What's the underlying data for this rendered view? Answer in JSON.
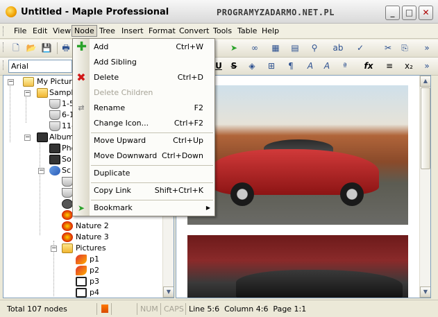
{
  "window": {
    "title": "Untitled - Maple Professional",
    "watermark": "PROGRAMYZADARMO.NET.PL",
    "min_glyph": "_",
    "max_glyph": "□",
    "close_glyph": "✕"
  },
  "menubar": {
    "items": [
      "File",
      "Edit",
      "View",
      "Node",
      "Tree",
      "Insert",
      "Format",
      "Convert",
      "Tools",
      "Table",
      "Help"
    ],
    "active_index": 3
  },
  "font_combo": {
    "value": "Arial"
  },
  "tree": {
    "nodes": [
      {
        "label": "My Picture",
        "icon": "book-icon"
      },
      {
        "label": "Sample",
        "icon": "folder-icon"
      },
      {
        "label": "1-5",
        "icon": "cup-icon"
      },
      {
        "label": "6-1",
        "icon": "cup-icon"
      },
      {
        "label": "11-",
        "icon": "cup-icon"
      },
      {
        "label": "Album",
        "icon": "camera-icon"
      },
      {
        "label": "Pho",
        "icon": "camera-icon"
      },
      {
        "label": "So",
        "icon": "camera-icon"
      },
      {
        "label": "Sc",
        "icon": "tools-icon"
      },
      {
        "label": "Nature 2",
        "icon": "burst-icon"
      },
      {
        "label": "Nature 3",
        "icon": "burst-icon"
      },
      {
        "label": "Pictures",
        "icon": "folder-icon"
      },
      {
        "label": "p1",
        "icon": "butterfly-icon"
      },
      {
        "label": "p2",
        "icon": "butterfly-icon"
      },
      {
        "label": "p3",
        "icon": "frame-icon"
      },
      {
        "label": "p4",
        "icon": "frame-icon"
      }
    ]
  },
  "node_menu": {
    "items": [
      {
        "label": "Add",
        "shortcut": "Ctrl+W",
        "icon": "plus-icon"
      },
      {
        "label": "Add Sibling",
        "shortcut": ""
      },
      {
        "label": "Delete",
        "shortcut": "Ctrl+D",
        "icon": "delete-x-icon"
      },
      {
        "label": "Delete Children",
        "shortcut": "",
        "disabled": true
      },
      {
        "label": "Rename",
        "shortcut": "F2"
      },
      {
        "label": "Change Icon...",
        "shortcut": "Ctrl+F2"
      },
      {
        "label": "Move Upward",
        "shortcut": "Ctrl+Up"
      },
      {
        "label": "Move Downward",
        "shortcut": "Ctrl+Down"
      },
      {
        "label": "Duplicate",
        "shortcut": ""
      },
      {
        "label": "Copy Link",
        "shortcut": "Shift+Ctrl+K"
      },
      {
        "label": "Bookmark",
        "shortcut": "",
        "submenu": true
      }
    ]
  },
  "statusbar": {
    "total": "Total 107 nodes",
    "num": "NUM",
    "caps": "CAPS",
    "position": "Line 5:6  Column 4:6  Page 1:1"
  },
  "colors": {
    "accent_blue": "#2b4f8f",
    "delete_red": "#d01818",
    "add_green": "#2aa22a"
  }
}
